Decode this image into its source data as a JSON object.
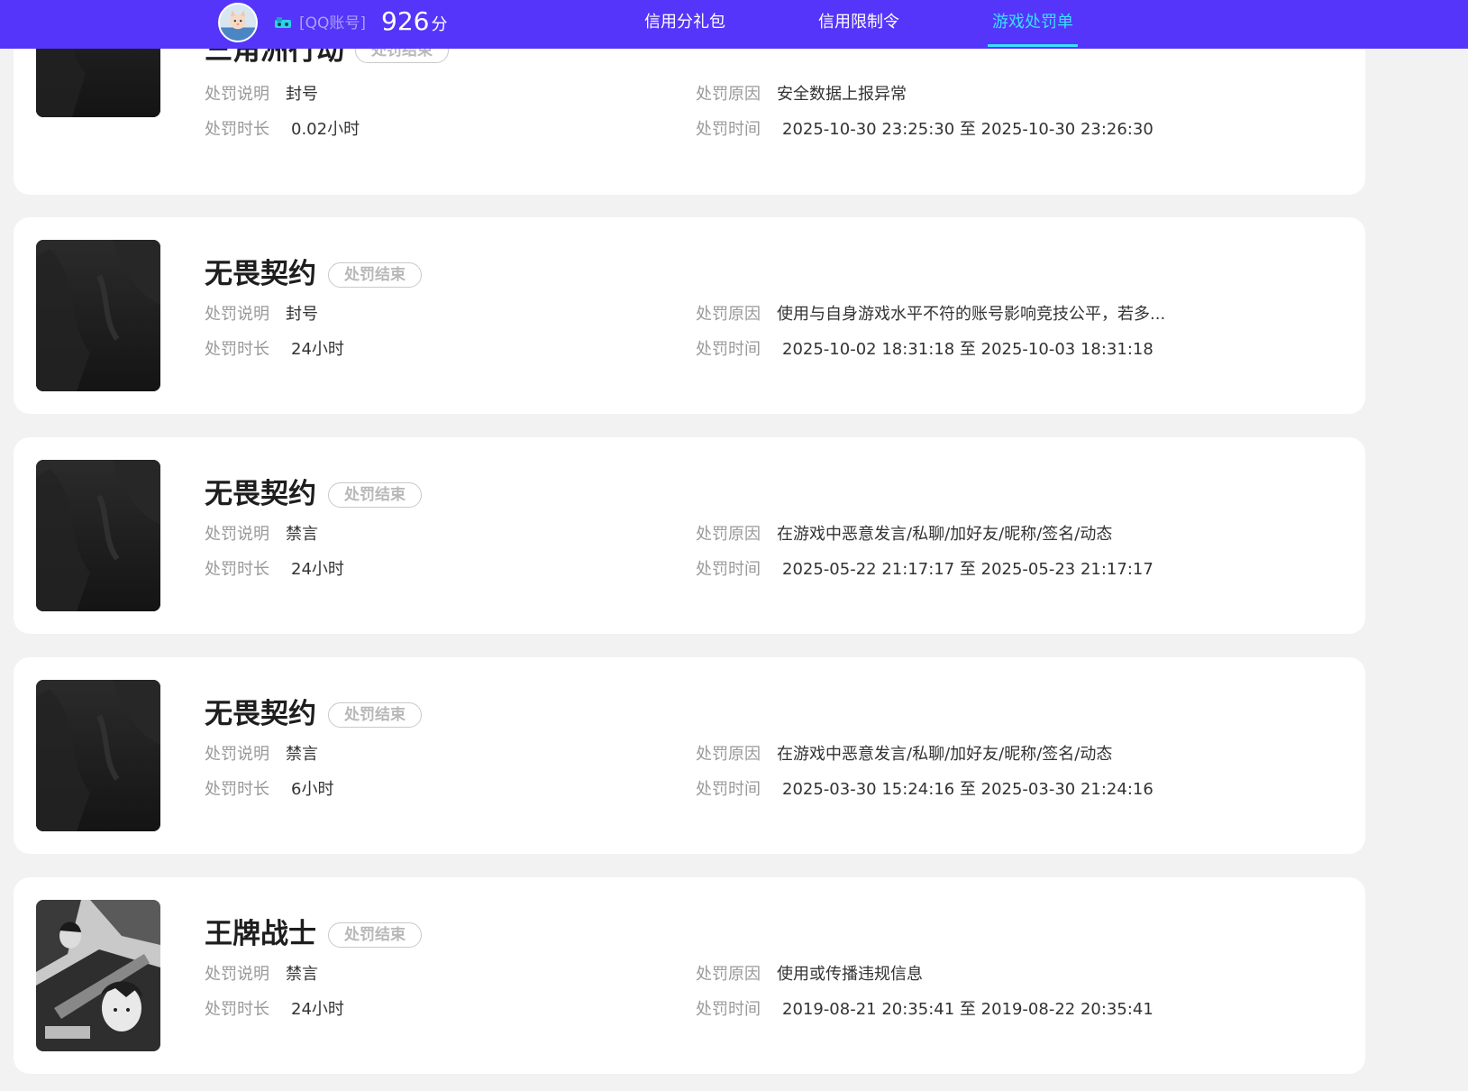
{
  "header": {
    "account_type_label": "[QQ账号]",
    "score_value": "926",
    "score_unit": "分",
    "accent_color": "#5535f9",
    "active_tab_color": "#39e0ff",
    "tabs": [
      {
        "label": "信用分礼包",
        "active": false
      },
      {
        "label": "信用限制令",
        "active": false
      },
      {
        "label": "游戏处罚单",
        "active": true
      }
    ]
  },
  "field_labels": {
    "description": "处罚说明",
    "duration": "处罚时长",
    "reason": "处罚原因",
    "time": "处罚时间"
  },
  "records": [
    {
      "game": "三角洲行动",
      "status": "处罚结束",
      "description": "封号",
      "duration": "0.02小时",
      "reason": "安全数据上报异常",
      "time": "2025-10-30 23:25:30 至 2025-10-30 23:26:30",
      "cover_icon": "dark-game-cover"
    },
    {
      "game": "无畏契约",
      "status": "处罚结束",
      "description": "封号",
      "duration": "24小时",
      "reason": "使用与自身游戏水平不符的账号影响竞技公平，若多...",
      "time": "2025-10-02 18:31:18 至 2025-10-03 18:31:18",
      "cover_icon": "dark-game-cover"
    },
    {
      "game": "无畏契约",
      "status": "处罚结束",
      "description": "禁言",
      "duration": "24小时",
      "reason": "在游戏中恶意发言/私聊/加好友/昵称/签名/动态",
      "time": "2025-05-22 21:17:17 至 2025-05-23 21:17:17",
      "cover_icon": "dark-game-cover"
    },
    {
      "game": "无畏契约",
      "status": "处罚结束",
      "description": "禁言",
      "duration": "6小时",
      "reason": "在游戏中恶意发言/私聊/加好友/昵称/签名/动态",
      "time": "2025-03-30 15:24:16 至 2025-03-30 21:24:16",
      "cover_icon": "dark-game-cover"
    },
    {
      "game": "王牌战士",
      "status": "处罚结束",
      "description": "禁言",
      "duration": "24小时",
      "reason": "使用或传播违规信息",
      "time": "2019-08-21 20:35:41 至 2019-08-22 20:35:41",
      "cover_icon": "anime-soldiers-cover"
    }
  ]
}
